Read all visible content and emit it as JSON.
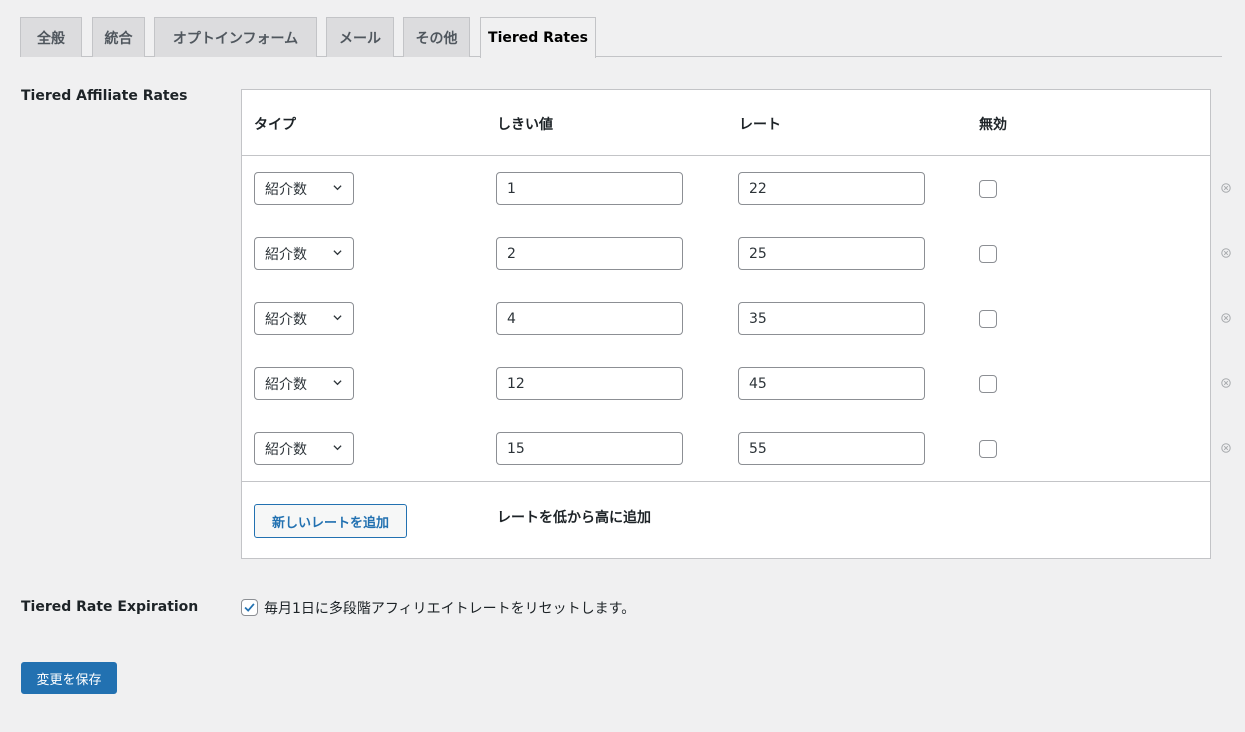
{
  "tabs": [
    "全般",
    "統合",
    "オプトインフォーム",
    "メール",
    "その他",
    "Tiered Rates"
  ],
  "active_tab": "Tiered Rates",
  "section": {
    "label": "Tiered Affiliate Rates",
    "columns": [
      "タイプ",
      "しきい値",
      "レート",
      "無効"
    ],
    "rows": [
      {
        "type": "紹介数",
        "threshold": "1",
        "rate": "22",
        "disabled": false
      },
      {
        "type": "紹介数",
        "threshold": "2",
        "rate": "25",
        "disabled": false
      },
      {
        "type": "紹介数",
        "threshold": "4",
        "rate": "35",
        "disabled": false
      },
      {
        "type": "紹介数",
        "threshold": "12",
        "rate": "45",
        "disabled": false
      },
      {
        "type": "紹介数",
        "threshold": "15",
        "rate": "55",
        "disabled": false
      }
    ],
    "add_button": "新しいレートを追加",
    "add_note": "レートを低から高に追加"
  },
  "expiration": {
    "label": "Tiered Rate Expiration",
    "checked": true,
    "text": "毎月1日に多段階アフィリエイトレートをリセットします。"
  },
  "save_button": "変更を保存",
  "colors": {
    "accent": "#2271b1",
    "background": "#f0f0f1",
    "border": "#c3c4c7"
  }
}
